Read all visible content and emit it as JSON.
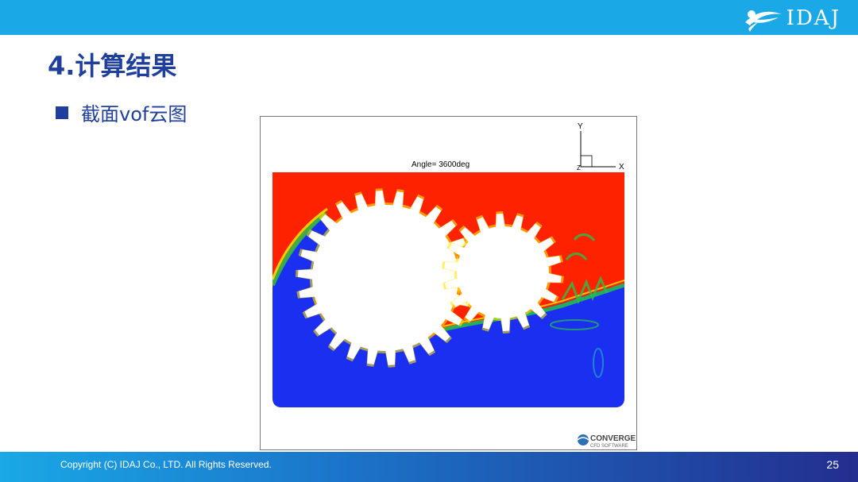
{
  "header": {
    "logo_text": "IDAJ",
    "bar_color": "#1aa8e6"
  },
  "slide": {
    "title": "4.计算结果",
    "bullet_text": "截面vof云图",
    "title_color": "#1f3f9a"
  },
  "simulation": {
    "angle_label": "Angle= 3600deg",
    "axis_y": "Y",
    "axis_x": "X",
    "axis_z": "Z",
    "brand_name": "CONVERGE",
    "brand_sub": "CFD SOFTWARE",
    "colors": {
      "liquid": "#1a2ff0",
      "gas": "#ff2200",
      "transition_mid": "#26c24a",
      "transition_yellow": "#ffe600"
    }
  },
  "footer": {
    "copyright": "Copyright (C)  IDAJ Co., LTD. All Rights Reserved.",
    "page_number": "25"
  }
}
